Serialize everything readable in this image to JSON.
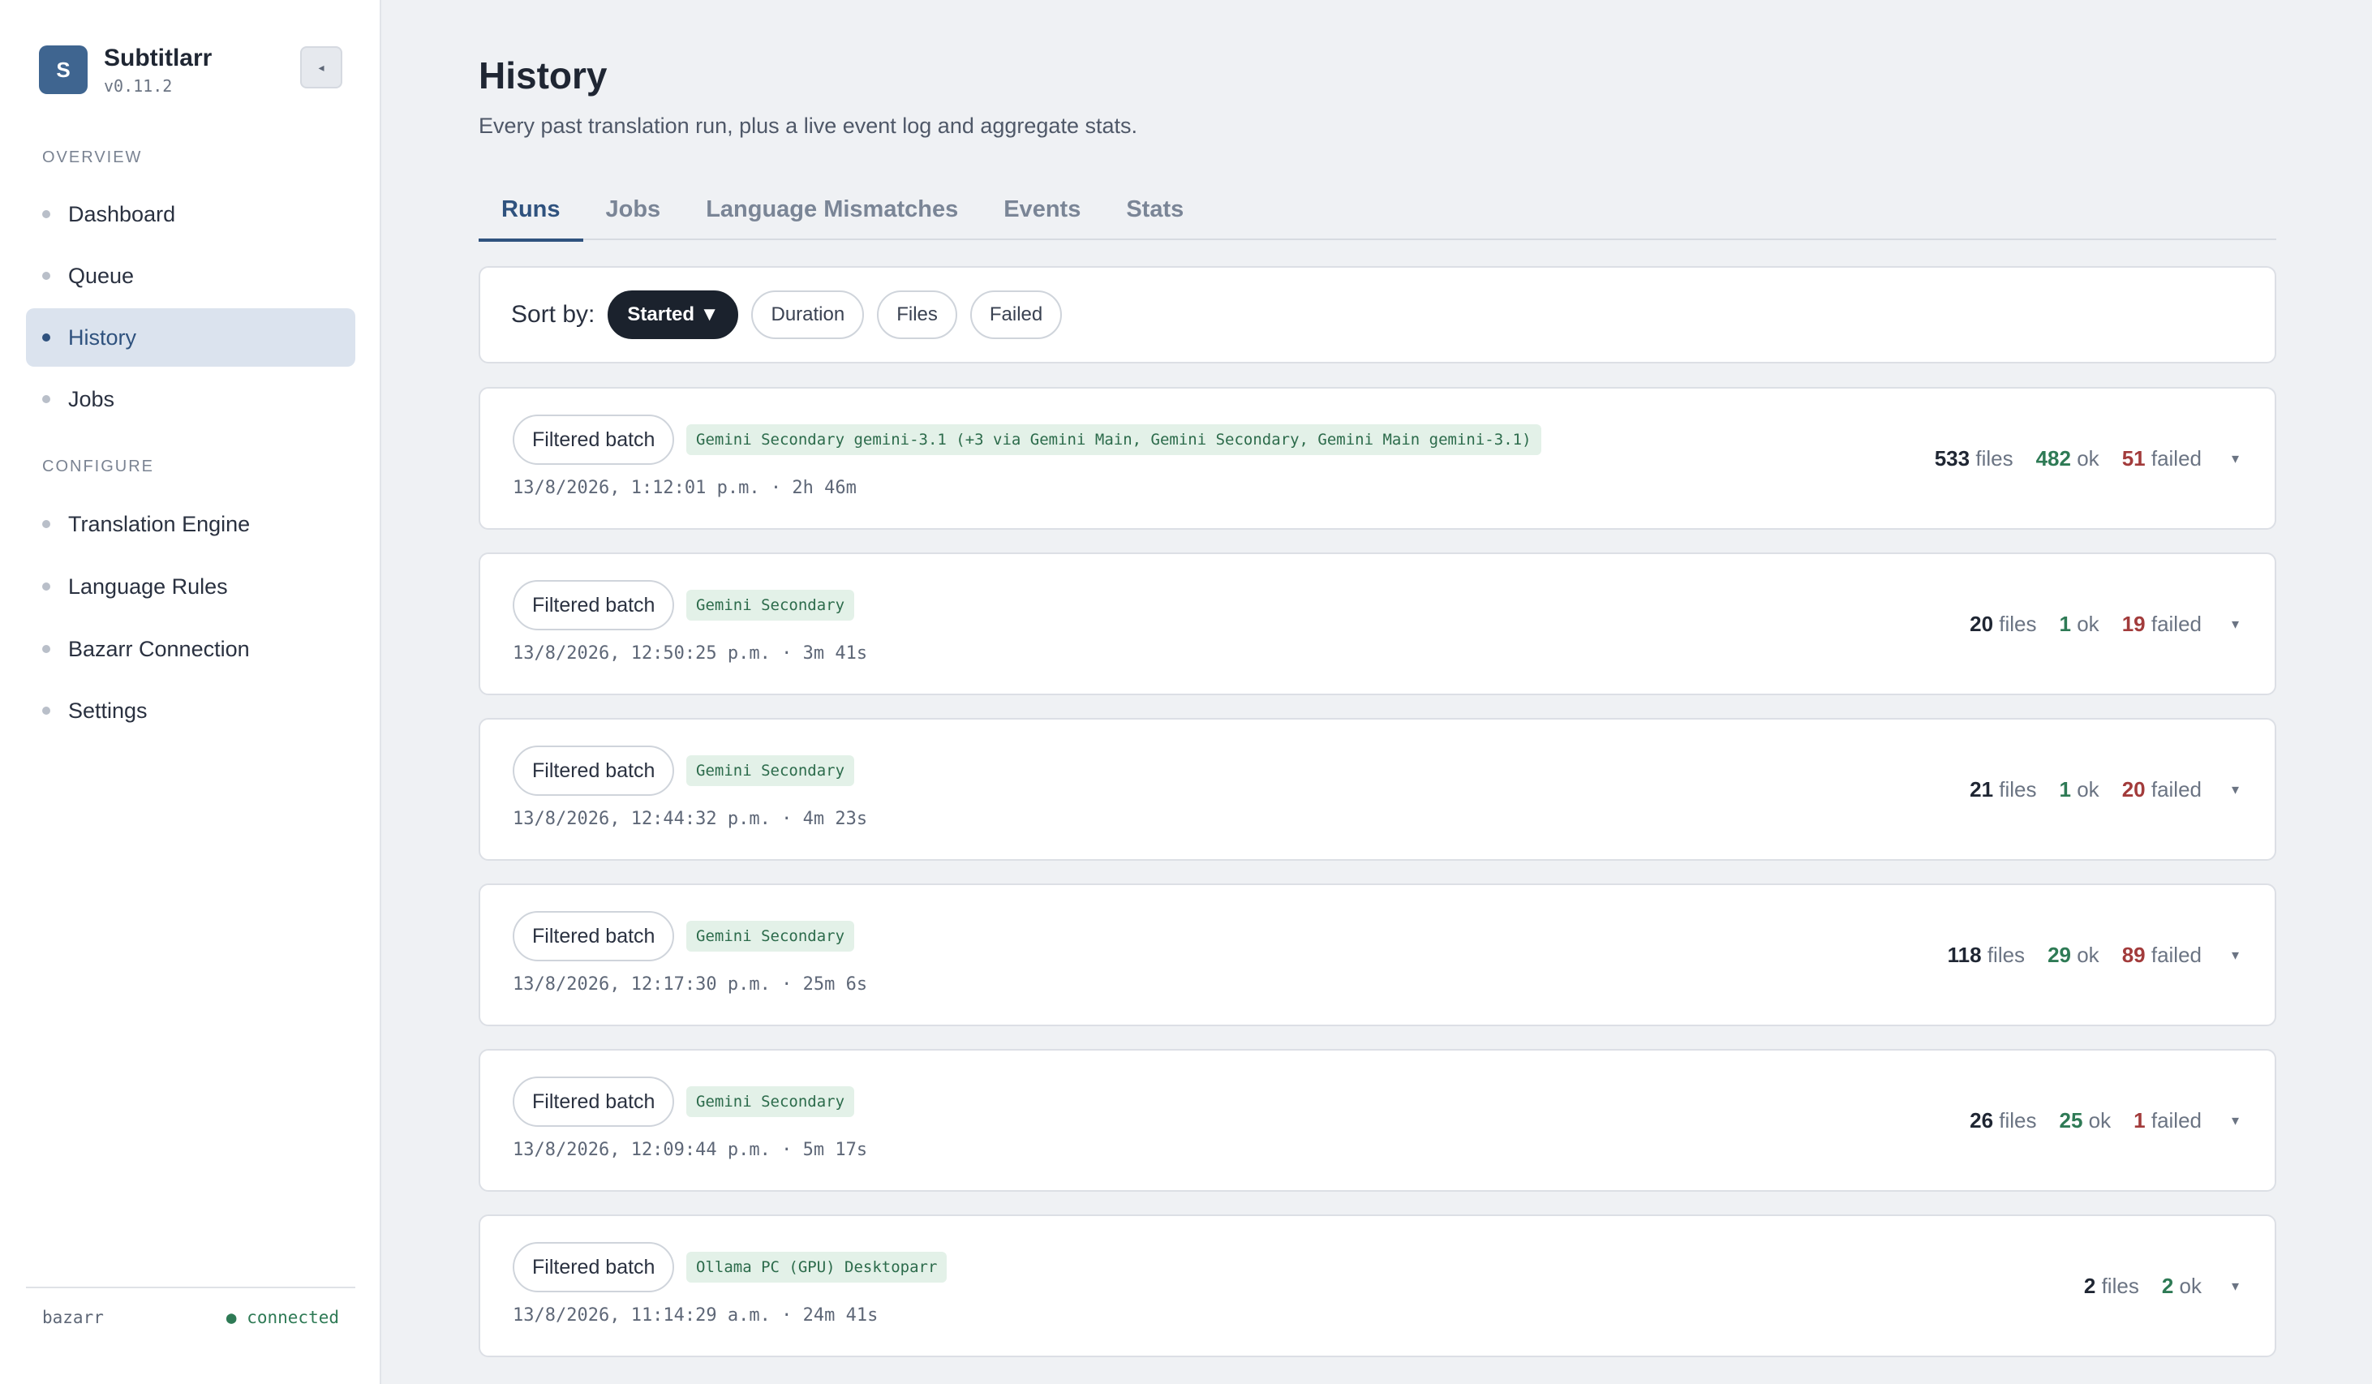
{
  "app": {
    "name": "Subtitlarr",
    "version": "v0.11.2",
    "logo_letter": "S",
    "collapse_glyph": "◂"
  },
  "sidebar": {
    "sections": [
      {
        "label": "OVERVIEW",
        "items": [
          {
            "label": "Dashboard",
            "active": false
          },
          {
            "label": "Queue",
            "active": false
          },
          {
            "label": "History",
            "active": true
          },
          {
            "label": "Jobs",
            "active": false
          }
        ]
      },
      {
        "label": "CONFIGURE",
        "items": [
          {
            "label": "Translation Engine",
            "active": false
          },
          {
            "label": "Language Rules",
            "active": false
          },
          {
            "label": "Bazarr Connection",
            "active": false
          },
          {
            "label": "Settings",
            "active": false
          }
        ]
      }
    ],
    "footer": {
      "service": "bazarr",
      "status": "● connected"
    }
  },
  "page": {
    "title": "History",
    "subtitle": "Every past translation run, plus a live event log and aggregate stats."
  },
  "tabs": [
    {
      "label": "Runs",
      "active": true
    },
    {
      "label": "Jobs",
      "active": false
    },
    {
      "label": "Language Mismatches",
      "active": false
    },
    {
      "label": "Events",
      "active": false
    },
    {
      "label": "Stats",
      "active": false
    }
  ],
  "sort": {
    "label": "Sort by:",
    "options": [
      {
        "label": "Started ▼",
        "active": true
      },
      {
        "label": "Duration",
        "active": false
      },
      {
        "label": "Files",
        "active": false
      },
      {
        "label": "Failed",
        "active": false
      }
    ]
  },
  "runs": [
    {
      "type": "Filtered batch",
      "engine": "Gemini Secondary gemini-3.1 (+3 via Gemini Main, Gemini Secondary, Gemini Main gemini-3.1)",
      "meta": "13/8/2026, 1:12:01 p.m. · 2h 46m",
      "files": "533",
      "ok": "482",
      "failed": "51"
    },
    {
      "type": "Filtered batch",
      "engine": "Gemini Secondary",
      "meta": "13/8/2026, 12:50:25 p.m. · 3m 41s",
      "files": "20",
      "ok": "1",
      "failed": "19"
    },
    {
      "type": "Filtered batch",
      "engine": "Gemini Secondary",
      "meta": "13/8/2026, 12:44:32 p.m. · 4m 23s",
      "files": "21",
      "ok": "1",
      "failed": "20"
    },
    {
      "type": "Filtered batch",
      "engine": "Gemini Secondary",
      "meta": "13/8/2026, 12:17:30 p.m. · 25m 6s",
      "files": "118",
      "ok": "29",
      "failed": "89"
    },
    {
      "type": "Filtered batch",
      "engine": "Gemini Secondary",
      "meta": "13/8/2026, 12:09:44 p.m. · 5m 17s",
      "files": "26",
      "ok": "25",
      "failed": "1"
    },
    {
      "type": "Filtered batch",
      "engine": "Ollama PC (GPU) Desktoparr",
      "meta": "13/8/2026, 11:14:29 a.m. · 24m 41s",
      "files": "2",
      "ok": "2",
      "failed": null
    }
  ],
  "labels": {
    "files": "files",
    "ok": "ok",
    "failed": "failed",
    "expand_glyph": "▾"
  },
  "colors": {
    "accent": "#2f527e",
    "ok": "#2e7a55",
    "failed": "#a23b3b",
    "logo": "#3f6590"
  }
}
